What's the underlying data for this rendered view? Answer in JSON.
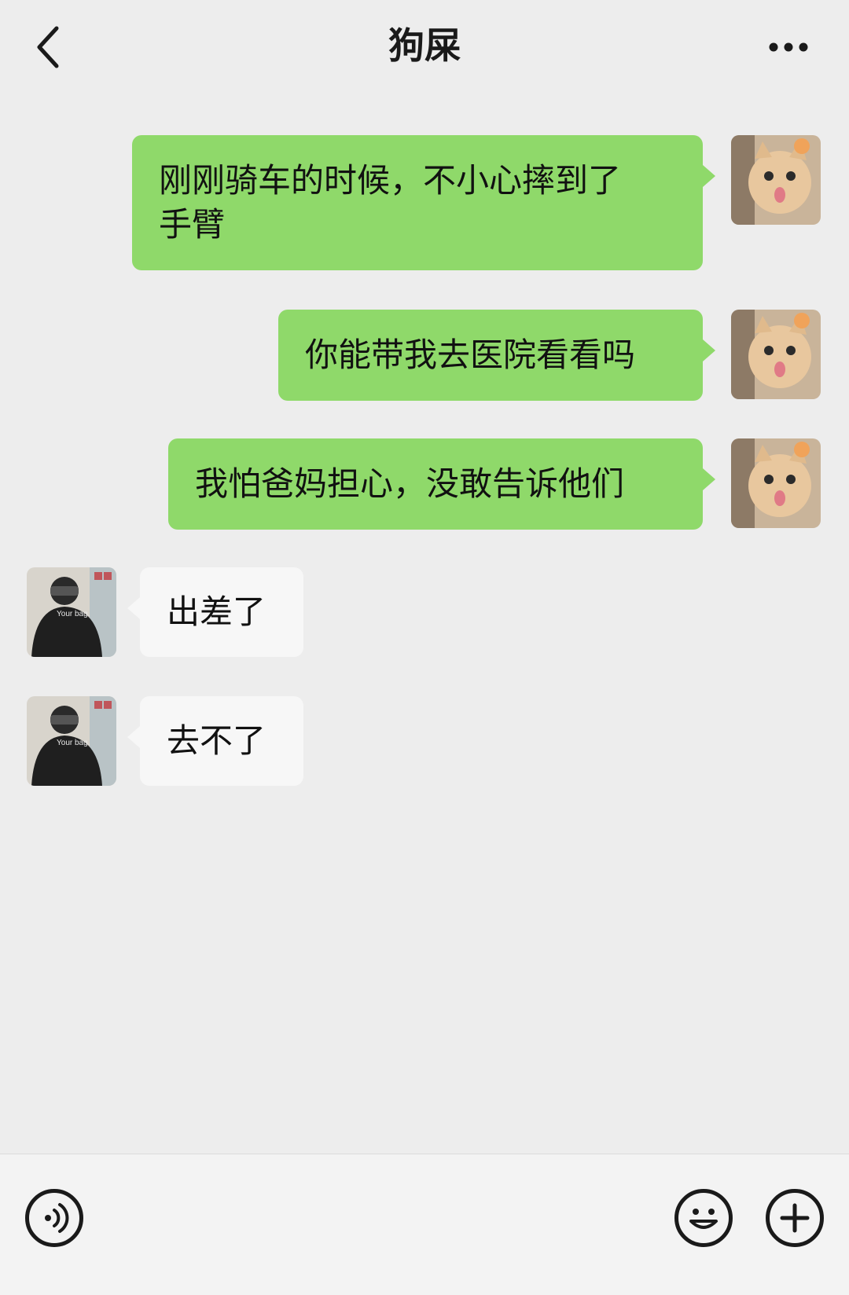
{
  "header": {
    "title": "狗屎",
    "back_icon": "chevron-left-icon",
    "more_icon": "more-dots-icon"
  },
  "messages": [
    {
      "sender": "me",
      "text_line1": "刚刚骑车的时候，不小心摔到了",
      "text_line2": "手臂"
    },
    {
      "sender": "me",
      "text": "你能带我去医院看看吗"
    },
    {
      "sender": "me",
      "text": "我怕爸妈担心，没敢告诉他们"
    },
    {
      "sender": "them",
      "text": "出差了"
    },
    {
      "sender": "them",
      "text": "去不了"
    }
  ],
  "avatars": {
    "me": "cat-avatar",
    "them": "person-avatar",
    "them_caption": "Your bag."
  },
  "input_bar": {
    "voice_icon": "voice-icon",
    "emoji_icon": "emoji-icon",
    "plus_icon": "plus-icon"
  },
  "colors": {
    "background": "#ededed",
    "my_bubble": "#8fd96a",
    "their_bubble": "#f7f7f7"
  }
}
